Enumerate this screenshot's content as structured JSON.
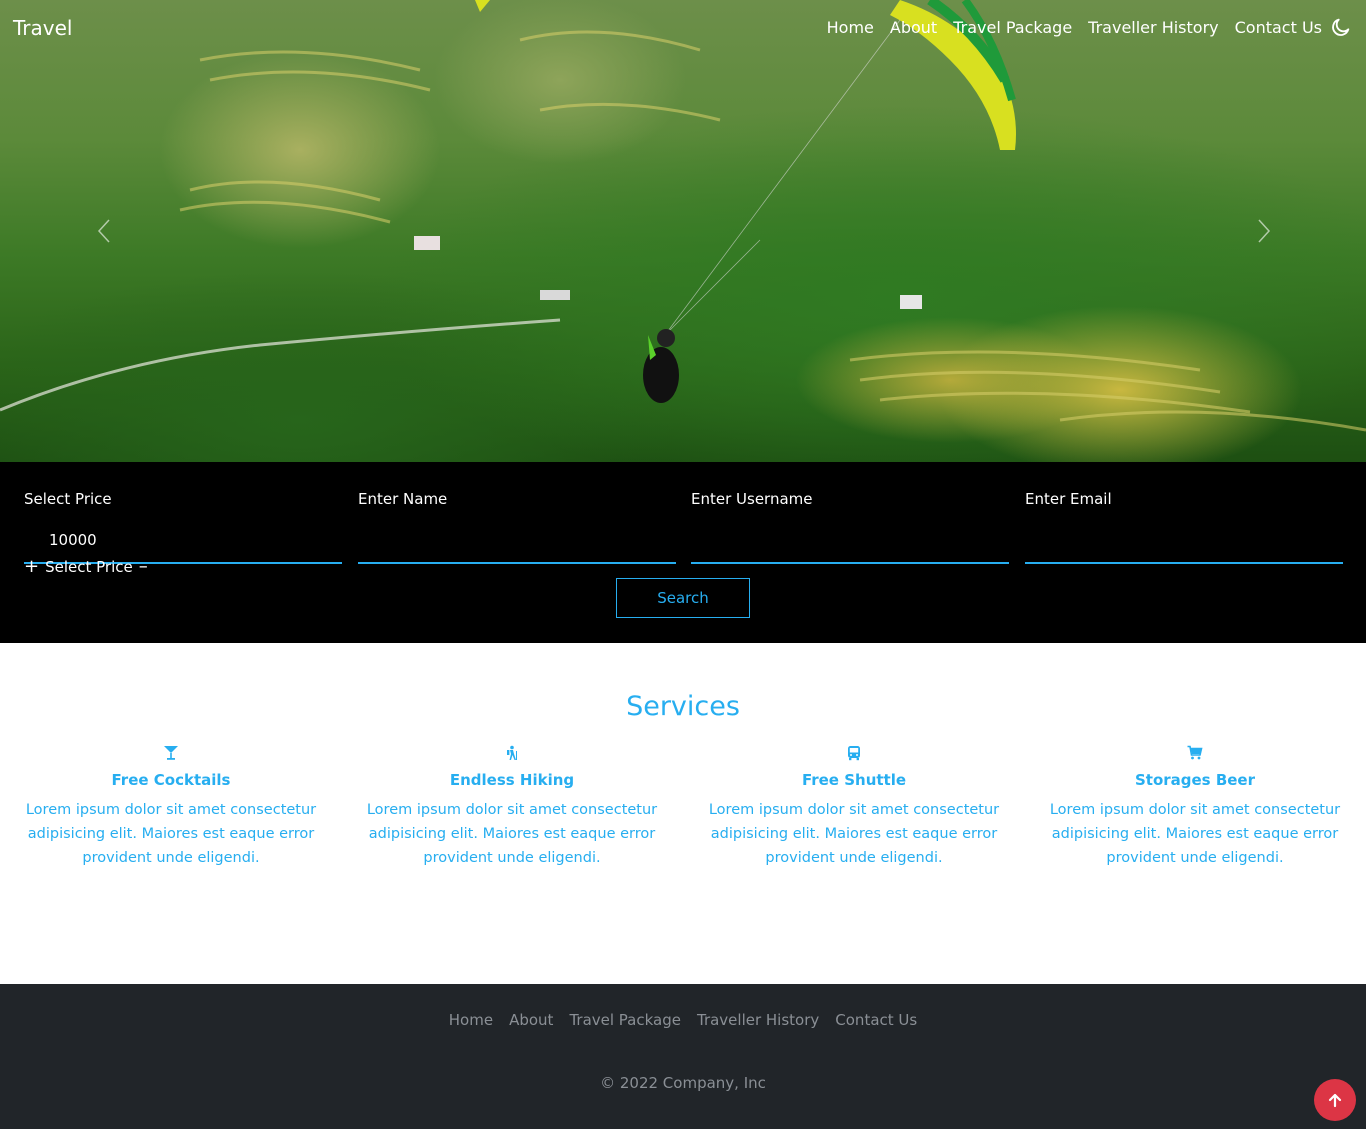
{
  "header": {
    "brand": "Travel",
    "nav": [
      "Home",
      "About",
      "Travel Package",
      "Traveller History",
      "Contact Us"
    ]
  },
  "search": {
    "fields": [
      {
        "label": "Select Price",
        "value": "10000"
      },
      {
        "label": "Enter Name",
        "value": ""
      },
      {
        "label": "Enter Username",
        "value": ""
      },
      {
        "label": "Enter Email",
        "value": ""
      }
    ],
    "stepper_label": "Select Price",
    "button": "Search"
  },
  "services": {
    "title": "Services",
    "items": [
      {
        "icon": "cocktail-icon",
        "title": "Free Cocktails",
        "text": "Lorem ipsum dolor sit amet consectetur adipisicing elit. Maiores est eaque error provident unde eligendi."
      },
      {
        "icon": "hiking-icon",
        "title": "Endless Hiking",
        "text": "Lorem ipsum dolor sit amet consectetur adipisicing elit. Maiores est eaque error provident unde eligendi."
      },
      {
        "icon": "bus-icon",
        "title": "Free Shuttle",
        "text": "Lorem ipsum dolor sit amet consectetur adipisicing elit. Maiores est eaque error provident unde eligendi."
      },
      {
        "icon": "cart-icon",
        "title": "Storages Beer",
        "text": "Lorem ipsum dolor sit amet consectetur adipisicing elit. Maiores est eaque error provident unde eligendi."
      }
    ]
  },
  "footer": {
    "nav": [
      "Home",
      "About",
      "Travel Package",
      "Traveller History",
      "Contact Us"
    ],
    "copyright": "© 2022 Company, Inc"
  },
  "colors": {
    "accent": "#27aef0",
    "search_bg": "#000000",
    "footer_bg": "#212529",
    "back_to_top": "#dc3545"
  }
}
